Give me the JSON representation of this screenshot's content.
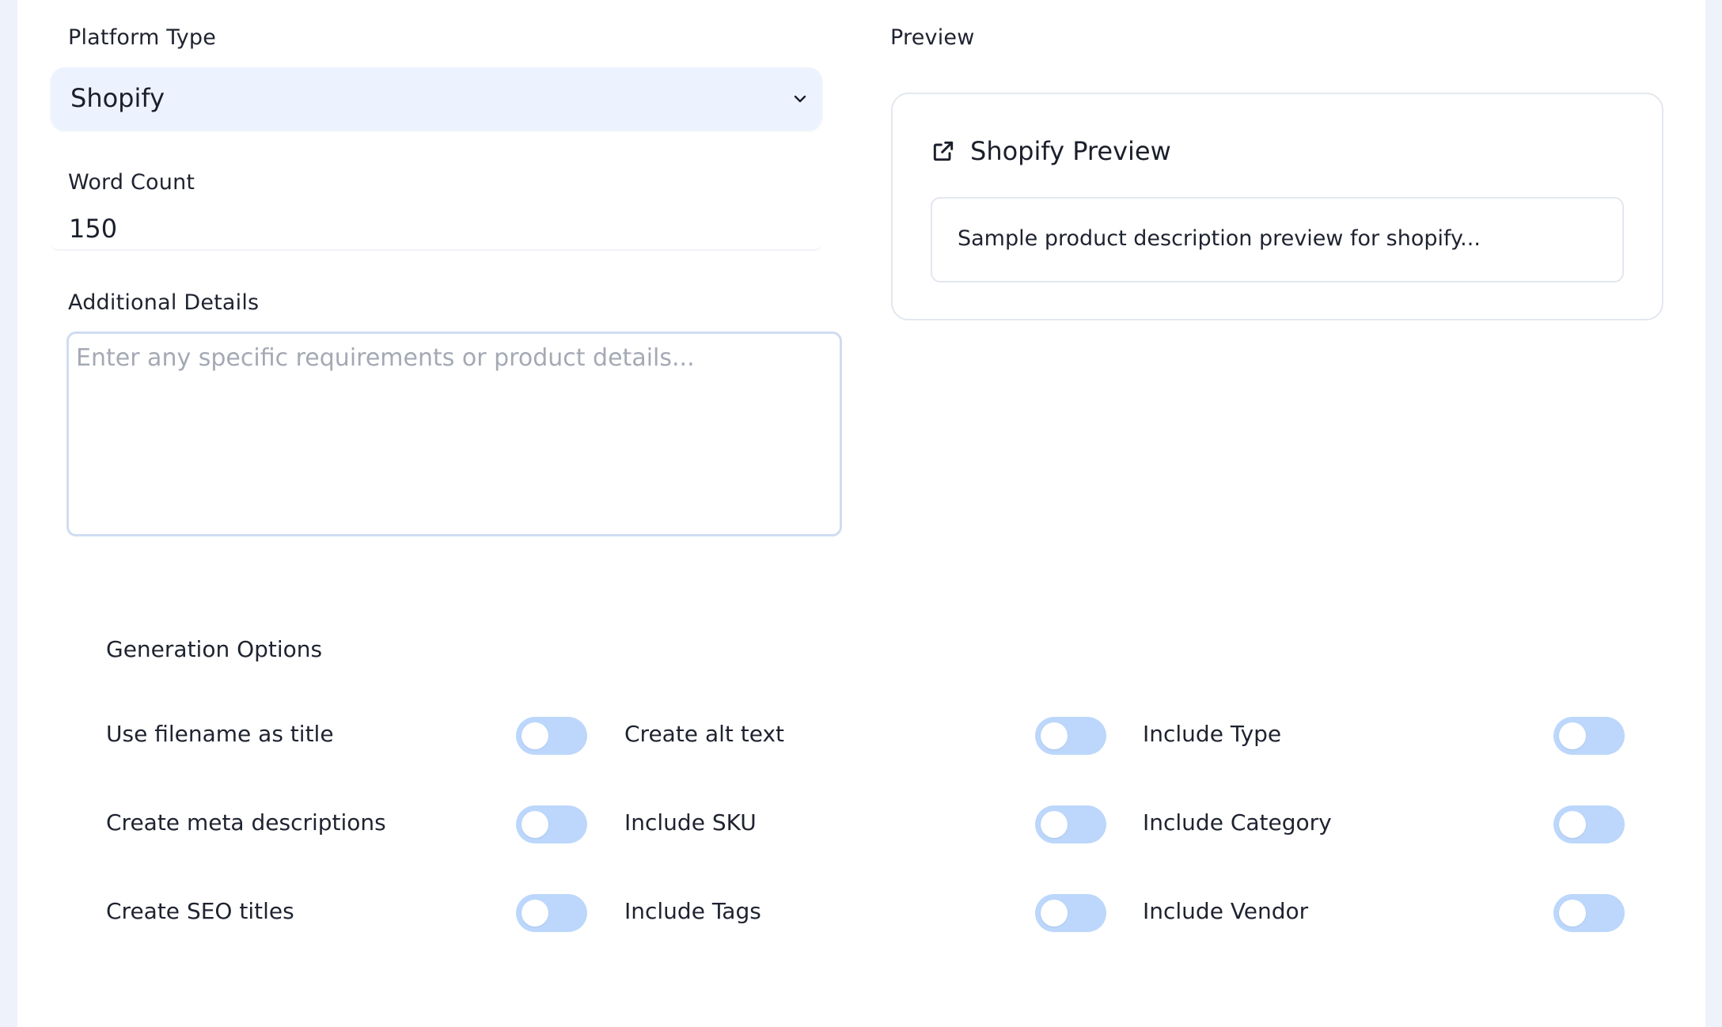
{
  "form": {
    "platform_type_label": "Platform Type",
    "platform_type_value": "Shopify",
    "word_count_label": "Word Count",
    "word_count_value": "150",
    "additional_details_label": "Additional Details",
    "additional_details_placeholder": "Enter any specific requirements or product details..."
  },
  "preview": {
    "label": "Preview",
    "title": "Shopify Preview",
    "icon": "external-link-icon",
    "text": "Sample product description preview for shopify..."
  },
  "options": {
    "heading": "Generation Options",
    "items": [
      {
        "label": "Use filename as title",
        "enabled": false
      },
      {
        "label": "Create alt text",
        "enabled": false
      },
      {
        "label": "Include Type",
        "enabled": false
      },
      {
        "label": "Create meta descriptions",
        "enabled": false
      },
      {
        "label": "Include SKU",
        "enabled": false
      },
      {
        "label": "Include Category",
        "enabled": false
      },
      {
        "label": "Create SEO titles",
        "enabled": false
      },
      {
        "label": "Include Tags",
        "enabled": false
      },
      {
        "label": "Include Vendor",
        "enabled": false
      }
    ]
  },
  "colors": {
    "toggle_off": "#bcd7fb",
    "select_bg": "#edf3fe",
    "page_bg": "#eef2fb"
  }
}
